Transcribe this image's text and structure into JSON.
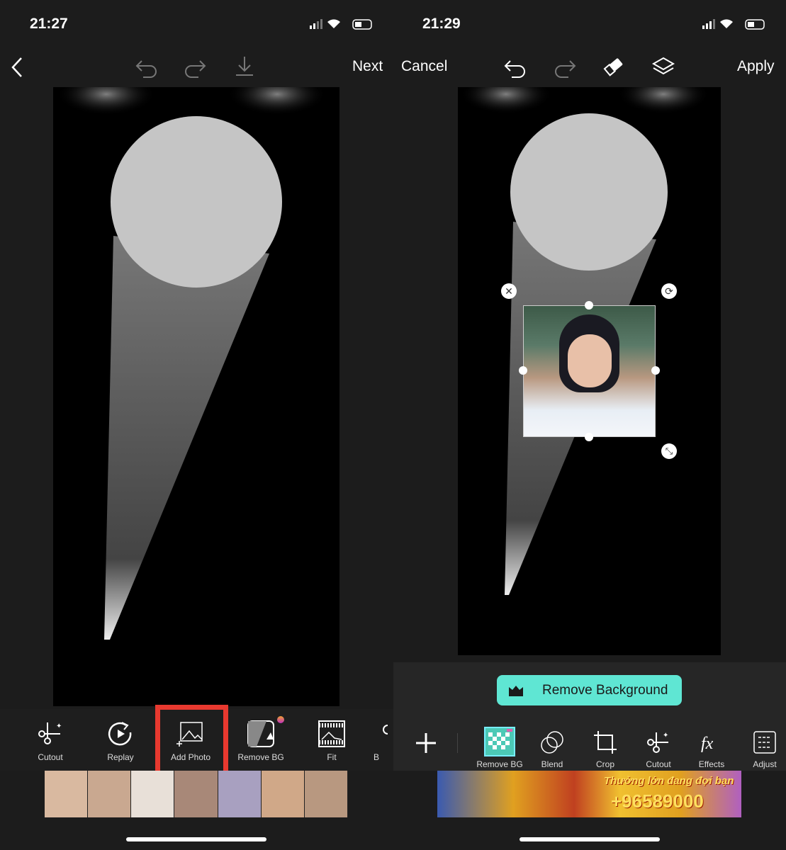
{
  "left": {
    "status_time": "21:27",
    "tools": [
      {
        "label": "Cutout",
        "icon": "scissors-sparkle-icon"
      },
      {
        "label": "Replay",
        "icon": "replay-icon"
      },
      {
        "label": "Add Photo",
        "icon": "add-photo-icon"
      },
      {
        "label": "Remove BG",
        "icon": "remove-bg-icon"
      },
      {
        "label": "Fit",
        "icon": "fit-icon"
      },
      {
        "label": "B",
        "icon": "brush-icon"
      }
    ],
    "highlight_color": "#e8392f"
  },
  "right": {
    "status_time": "21:29",
    "next_label": "Next",
    "cancel_label": "Cancel",
    "apply_label": "Apply",
    "remove_background_label": "Remove Background",
    "accent": "#5fe6d3",
    "tools": [
      {
        "label": "Remove BG",
        "icon": "remove-bg-icon"
      },
      {
        "label": "Blend",
        "icon": "blend-icon"
      },
      {
        "label": "Crop",
        "icon": "crop-icon"
      },
      {
        "label": "Cutout",
        "icon": "scissors-sparkle-icon"
      },
      {
        "label": "Effects",
        "icon": "fx-icon"
      },
      {
        "label": "Adjust",
        "icon": "adjust-icon"
      }
    ],
    "ad_text": "Thưởng lớn đang đợi bạn",
    "ad_amount": "+96589000"
  }
}
